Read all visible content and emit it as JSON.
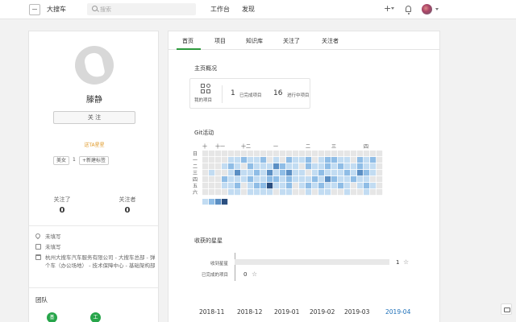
{
  "header": {
    "app_title": "大搜车",
    "search_placeholder": "搜索",
    "nav": [
      {
        "label": "工作台"
      },
      {
        "label": "发现"
      }
    ],
    "plus_glyph": "+"
  },
  "profile": {
    "name": "滕静",
    "follow_label": "关 注",
    "give_star": "送TA星星",
    "tags": [
      {
        "label": "美女"
      }
    ],
    "tag_count": "1",
    "new_tag": "+新建标签",
    "stats": [
      {
        "label": "关注了",
        "value": "0"
      },
      {
        "label": "关注者",
        "value": "0"
      }
    ],
    "info": [
      {
        "icon": "location-icon",
        "text": "未填写"
      },
      {
        "icon": "calendar-icon",
        "text": "未填写"
      },
      {
        "icon": "briefcase-icon",
        "text": "杭州大搜车汽车服务有限公司 - 大搜车总部 - 弹个车（办公场地） - 技术保障中心 - 基础架构部"
      }
    ],
    "team_title": "团队",
    "team": [
      {
        "initial": "基"
      },
      {
        "initial": "工"
      }
    ]
  },
  "tabs": [
    {
      "label": "首页",
      "active": true
    },
    {
      "label": "项目"
    },
    {
      "label": "知识库"
    },
    {
      "label": "关注了"
    },
    {
      "label": "关注者"
    }
  ],
  "overview": {
    "title": "主页概况",
    "my_projects": "我的项目",
    "done_count": "1",
    "done_label": "已完成项目",
    "ongoing_count": "16",
    "ongoing_label": "进行中项目"
  },
  "git": {
    "title": "Git活动",
    "month_labels": [
      "十",
      "十一",
      "十二",
      "一",
      "二",
      "三",
      "四"
    ],
    "weekday_labels": [
      "日",
      "一",
      "二",
      "三",
      "四",
      "五",
      "六"
    ],
    "colors": [
      "#e6e6e6",
      "#c2dcf2",
      "#8fbde6",
      "#5b8fc4",
      "#2b4f80"
    ],
    "grid": [
      [
        0,
        0,
        0,
        0,
        0,
        0,
        0,
        0,
        0,
        0,
        0,
        0,
        0,
        0,
        0,
        0,
        0,
        0,
        0,
        0,
        0,
        0,
        0,
        0,
        0,
        0,
        0,
        0
      ],
      [
        0,
        0,
        0,
        0,
        1,
        1,
        2,
        1,
        1,
        2,
        0,
        1,
        0,
        2,
        1,
        1,
        2,
        0,
        1,
        2,
        2,
        1,
        1,
        0,
        2,
        1,
        2,
        0
      ],
      [
        0,
        0,
        0,
        1,
        2,
        1,
        0,
        2,
        1,
        1,
        1,
        3,
        2,
        1,
        1,
        0,
        2,
        1,
        1,
        2,
        1,
        2,
        1,
        1,
        2,
        1,
        1,
        0
      ],
      [
        0,
        1,
        0,
        0,
        1,
        3,
        1,
        1,
        2,
        1,
        3,
        1,
        2,
        3,
        1,
        1,
        0,
        1,
        2,
        1,
        1,
        1,
        2,
        1,
        3,
        2,
        1,
        0
      ],
      [
        0,
        0,
        0,
        2,
        1,
        1,
        1,
        2,
        1,
        1,
        2,
        2,
        1,
        2,
        1,
        1,
        1,
        2,
        1,
        3,
        2,
        1,
        1,
        2,
        1,
        1,
        0,
        0
      ],
      [
        0,
        0,
        0,
        1,
        1,
        2,
        0,
        1,
        2,
        2,
        4,
        1,
        1,
        2,
        0,
        1,
        2,
        1,
        2,
        1,
        1,
        2,
        1,
        0,
        1,
        2,
        1,
        0
      ],
      [
        0,
        0,
        0,
        0,
        1,
        1,
        0,
        1,
        1,
        1,
        1,
        0,
        1,
        1,
        0,
        0,
        1,
        0,
        1,
        1,
        0,
        0,
        1,
        0,
        0,
        1,
        0,
        0
      ]
    ],
    "legend_levels": [
      1,
      2,
      3,
      4
    ]
  },
  "stars": {
    "title": "收获的星星",
    "rows": [
      {
        "label": "收到星星",
        "value": "1",
        "fraction": 1.0
      },
      {
        "label": "已完成的项目",
        "value": "0",
        "fraction": 0.0
      }
    ],
    "star_glyph": "☆"
  },
  "months": [
    {
      "label": "2018-11"
    },
    {
      "label": "2018-12"
    },
    {
      "label": "2019-01"
    },
    {
      "label": "2019-02"
    },
    {
      "label": "2019-03"
    },
    {
      "label": "2019-04",
      "active": true
    }
  ]
}
